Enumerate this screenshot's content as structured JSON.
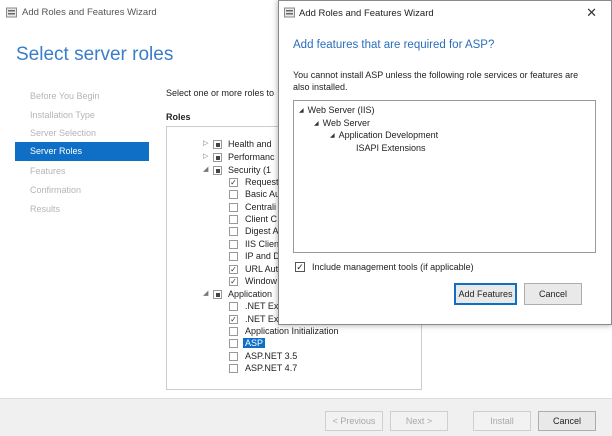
{
  "main_window": {
    "title": "Add Roles and Features Wizard",
    "heading": "Select server roles",
    "nav": [
      {
        "label": "Before You Begin"
      },
      {
        "label": "Installation Type"
      },
      {
        "label": "Server Selection"
      },
      {
        "label": "Server Roles",
        "selected": true
      },
      {
        "label": "Features"
      },
      {
        "label": "Confirmation"
      },
      {
        "label": "Results"
      }
    ],
    "intro_text": "Select one or more roles to",
    "roles_header": "Roles",
    "roles": [
      {
        "label": "Health and",
        "state": "partial",
        "expand": "▷"
      },
      {
        "label": "Performanc",
        "state": "partial",
        "expand": "▷"
      },
      {
        "label": "Security (1",
        "state": "partial",
        "expand": "◢"
      },
      {
        "label": "Request",
        "state": "checked"
      },
      {
        "label": "Basic Au",
        "state": "unchecked"
      },
      {
        "label": "Centrali",
        "state": "unchecked"
      },
      {
        "label": "Client C",
        "state": "unchecked"
      },
      {
        "label": "Digest A",
        "state": "unchecked"
      },
      {
        "label": "IIS Clien",
        "state": "unchecked"
      },
      {
        "label": "IP and D",
        "state": "unchecked"
      },
      {
        "label": "URL Aut",
        "state": "checked"
      },
      {
        "label": "Window",
        "state": "checked"
      },
      {
        "label": "Application",
        "state": "partial",
        "expand": "◢"
      },
      {
        "label": ".NET Ex",
        "state": "unchecked"
      },
      {
        "label": ".NET Ex",
        "state": "checked"
      },
      {
        "label": "Application Initialization",
        "state": "unchecked"
      },
      {
        "label": "ASP",
        "state": "unchecked",
        "highlight": true
      },
      {
        "label": "ASP.NET 3.5",
        "state": "unchecked"
      },
      {
        "label": "ASP.NET 4.7",
        "state": "unchecked"
      }
    ],
    "footer": {
      "previous": "< Previous",
      "next": "Next >",
      "install": "Install",
      "cancel": "Cancel"
    }
  },
  "dialog": {
    "title": "Add Roles and Features Wizard",
    "close_glyph": "✕",
    "heading": "Add features that are required for ASP?",
    "message": "You cannot install ASP unless the following role services or features are also installed.",
    "tree": [
      {
        "label": "Web Server (IIS)"
      },
      {
        "label": "Web Server"
      },
      {
        "label": "Application Development"
      },
      {
        "label": "ISAPI Extensions"
      }
    ],
    "include_tools_label": "Include management tools (if applicable)",
    "include_tools_checked": true,
    "add_features": "Add Features",
    "cancel": "Cancel"
  },
  "icons": {
    "app_icon": "server-manager-icon",
    "check": "✓",
    "expand_collapsed": "▷",
    "expand_open": "◢"
  },
  "colors": {
    "accent": "#0f6fc6",
    "heading_blue": "#3a7dc8",
    "dialog_heading_blue": "#2a6ebb",
    "nav_disabled": "#b5b5b5"
  }
}
